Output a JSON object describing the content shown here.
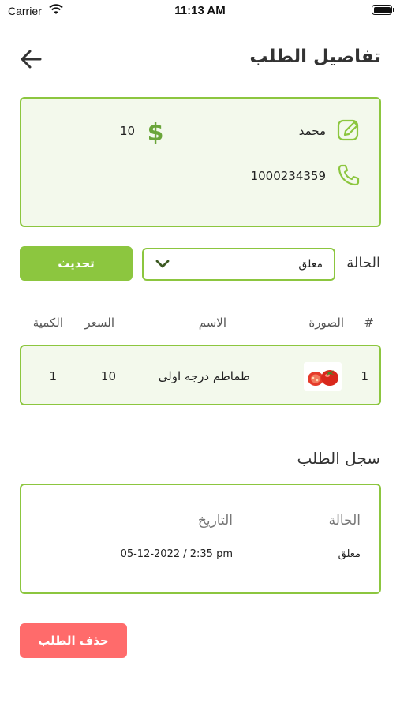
{
  "status_bar": {
    "carrier": "Carrier",
    "time": "11:13 AM"
  },
  "header": {
    "title": "تفاصيل الطلب",
    "back_icon": "arrow-left-icon"
  },
  "customer": {
    "name": "محمد",
    "phone": "1000234359",
    "amount": "10",
    "icons": {
      "name": "edit-icon",
      "phone": "phone-icon",
      "amount": "dollar-icon"
    }
  },
  "order_status": {
    "label": "الحالة",
    "selected": "معلق",
    "update_label": "تحديث"
  },
  "table": {
    "headers": {
      "index": "#",
      "image": "الصورة",
      "name": "الاسم",
      "price": "السعر",
      "quantity": "الكمية"
    },
    "rows": [
      {
        "index": "1",
        "name": "طماطم درجه اولى",
        "price": "10",
        "quantity": "1"
      }
    ]
  },
  "history": {
    "title": "سجل الطلب",
    "headers": {
      "status": "الحالة",
      "date": "التاريخ"
    },
    "rows": [
      {
        "status": "معلق",
        "date": "05-12-2022 / 2:35 pm"
      }
    ]
  },
  "actions": {
    "delete_label": "حذف الطلب"
  },
  "colors": {
    "accent": "#8cc63f",
    "card_bg": "#f3f9ec",
    "danger": "#ff6b6b"
  }
}
